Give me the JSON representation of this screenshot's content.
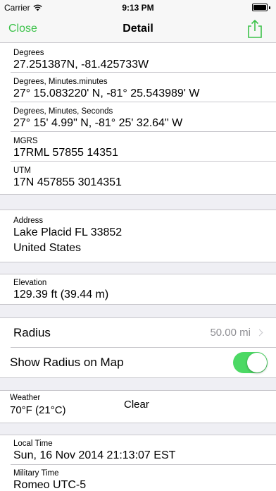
{
  "status": {
    "carrier": "Carrier",
    "time": "9:13 PM"
  },
  "nav": {
    "close_label": "Close",
    "title": "Detail",
    "share_icon": "share-icon"
  },
  "coordinates": {
    "degrees": {
      "label": "Degrees",
      "value": "27.251387N, -81.425733W"
    },
    "dmm": {
      "label": "Degrees, Minutes.minutes",
      "value": "27° 15.083220' N, -81° 25.543989' W"
    },
    "dms": {
      "label": "Degrees, Minutes, Seconds",
      "value": "27° 15' 4.99\" N, -81° 25' 32.64\" W"
    },
    "mgrs": {
      "label": "MGRS",
      "value": "17RML 57855 14351"
    },
    "utm": {
      "label": "UTM",
      "value": "17N 457855 3014351"
    }
  },
  "address": {
    "label": "Address",
    "line1": "Lake Placid FL 33852",
    "line2": "United States"
  },
  "elevation": {
    "label": "Elevation",
    "value": "129.39 ft (39.44 m)"
  },
  "radius": {
    "label": "Radius",
    "value": "50.00 mi",
    "show_label": "Show Radius on Map",
    "show_on": true
  },
  "weather": {
    "label": "Weather",
    "temp": "70°F (21°C)",
    "condition": "Clear"
  },
  "time_info": {
    "local": {
      "label": "Local Time",
      "value": "Sun, 16 Nov 2014 21:13:07 EST"
    },
    "military": {
      "label": "Military Time",
      "value": "Romeo UTC-5"
    }
  },
  "colors": {
    "accent": "#3cc24a",
    "toggle_on": "#4cd964",
    "background": "#efeff4"
  }
}
